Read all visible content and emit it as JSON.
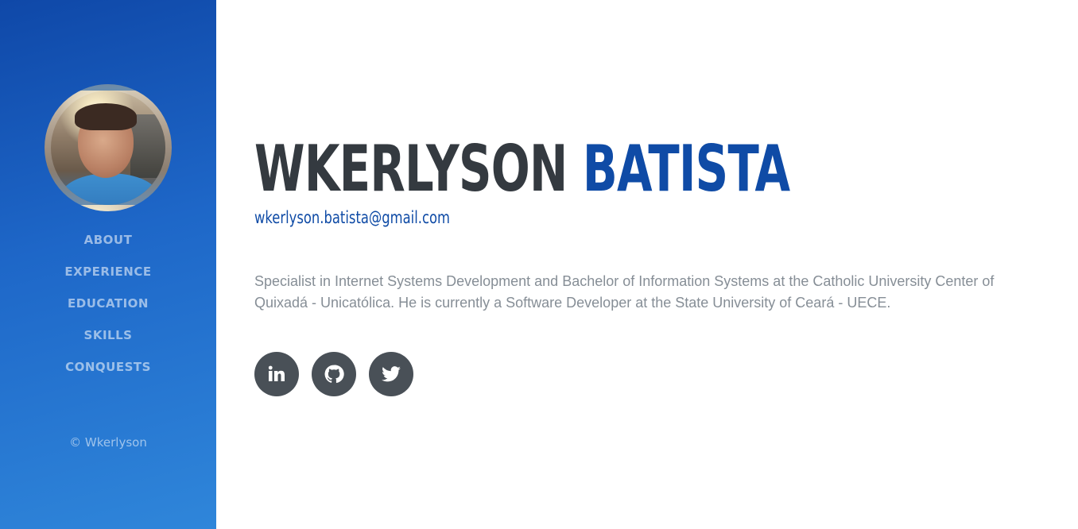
{
  "profile": {
    "first_name": "WKERLYSON",
    "last_name": "BATISTA",
    "email": "wkerlyson.batista@gmail.com",
    "bio": "Specialist in Internet Systems Development and Bachelor of Information Systems at the Catholic University Center of Quixadá - Unicatólica. He is currently a Software Developer at the State University of Ceará - UECE."
  },
  "sidebar": {
    "avatar_icon": "profile-photo",
    "items": [
      {
        "label": "ABOUT"
      },
      {
        "label": "EXPERIENCE"
      },
      {
        "label": "EDUCATION"
      },
      {
        "label": "SKILLS"
      },
      {
        "label": "CONQUESTS"
      }
    ],
    "copyright": "© Wkerlyson"
  },
  "socials": [
    {
      "icon": "linkedin-icon"
    },
    {
      "icon": "github-icon"
    },
    {
      "icon": "twitter-icon"
    }
  ],
  "colors": {
    "primary": "#0f4ba6",
    "sidebar_top": "#0f48a8",
    "sidebar_bottom": "#2f86da",
    "heading": "#343a40",
    "body_text": "#868e96",
    "social_bg": "#495057"
  }
}
